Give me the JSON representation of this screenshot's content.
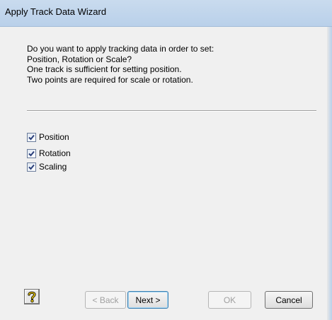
{
  "window": {
    "title": "Apply Track Data Wizard"
  },
  "message": {
    "lines": [
      "Do you want to apply tracking data in order to set:",
      "Position, Rotation or Scale?",
      "One track is sufficient for setting position.",
      "Two points are required for scale or rotation."
    ]
  },
  "options": [
    {
      "label": "Position",
      "checked": true
    },
    {
      "label": "Rotation",
      "checked": true
    },
    {
      "label": "Scaling",
      "checked": true
    }
  ],
  "buttons": {
    "back_label": "< Back",
    "next_label": "Next >",
    "ok_label": "OK",
    "cancel_label": "Cancel"
  },
  "icons": {
    "help": "help-question-icon",
    "check": "checkmark-icon"
  },
  "colors": {
    "titlebar": "#b9d0ea",
    "dialog_bg": "#f0f0f0",
    "check_mark": "#2a3f7a",
    "help_icon": "#d4b000"
  }
}
